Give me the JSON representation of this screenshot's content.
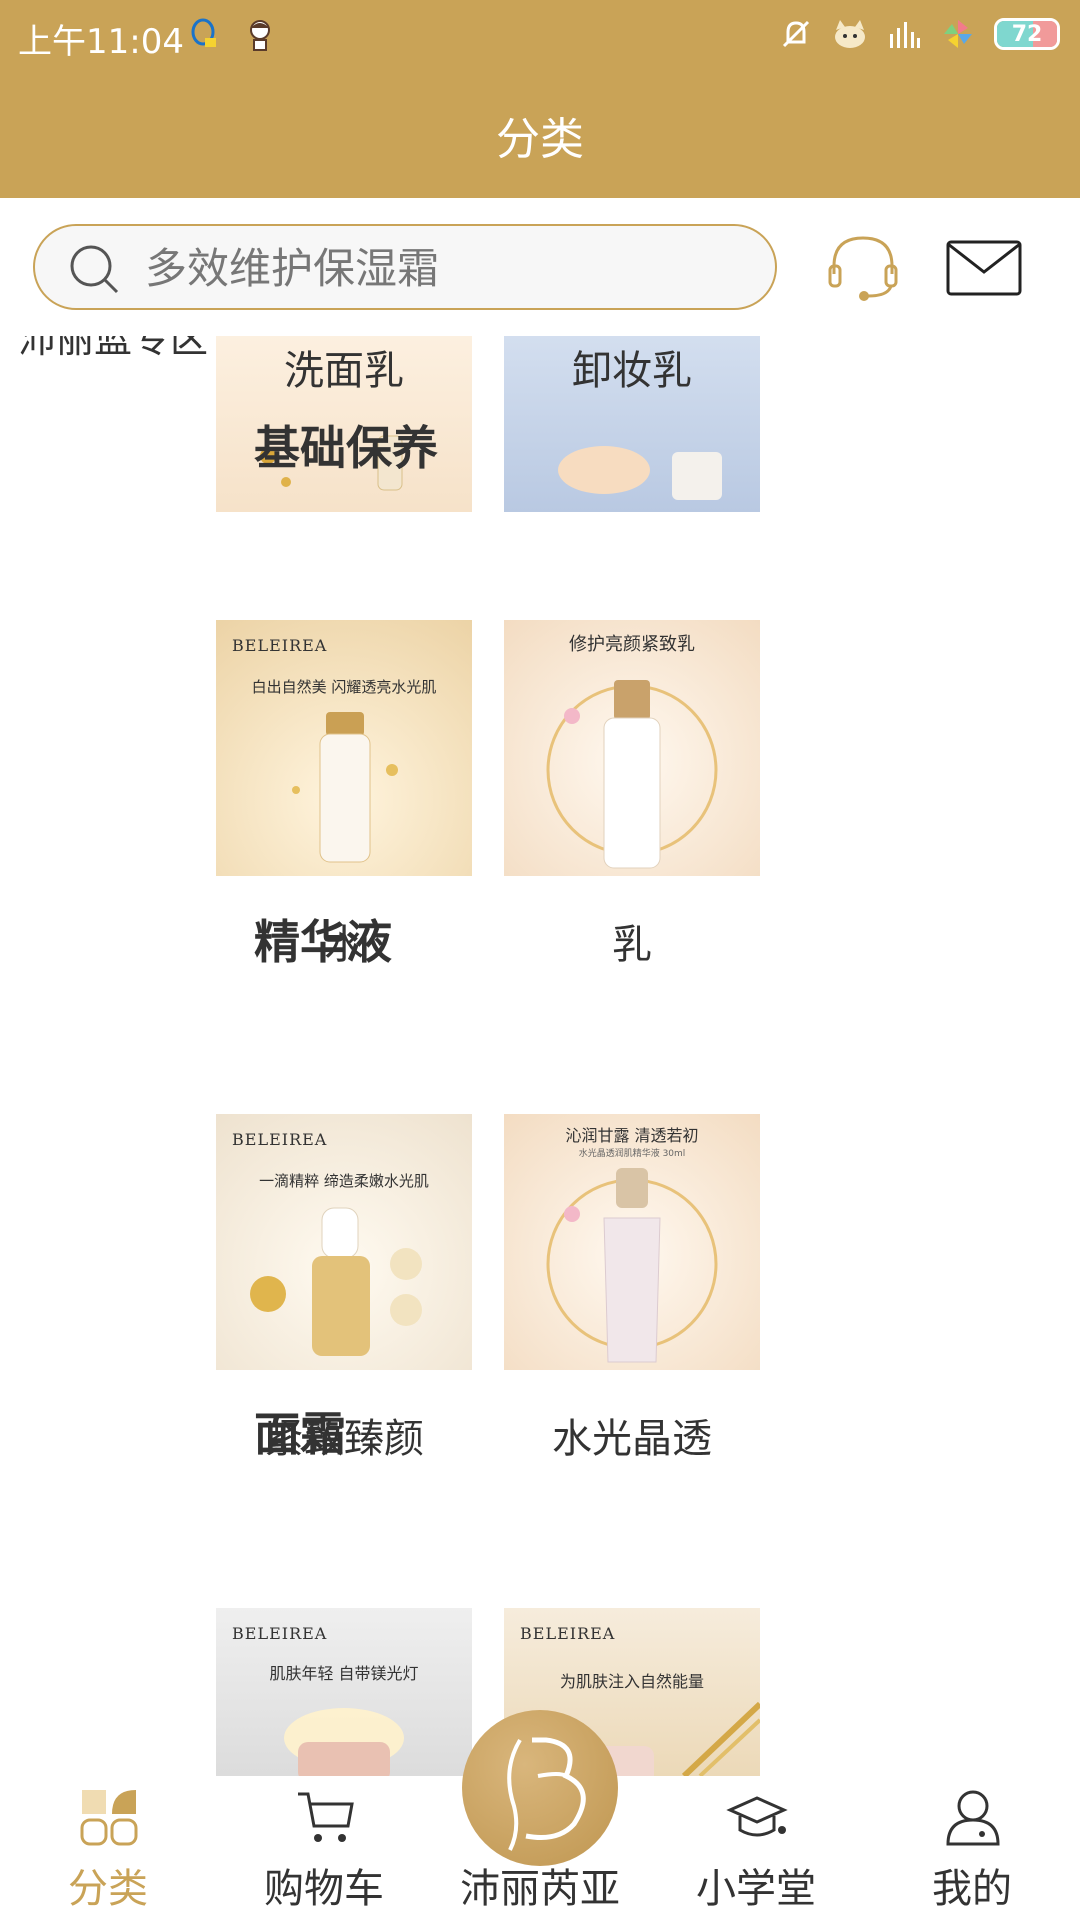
{
  "status_bar": {
    "time": "上午11:04",
    "battery": "72",
    "left_icons": [
      "qq-icon",
      "avatar-sticker-icon"
    ],
    "right_icons": [
      "mute-bell-icon",
      "cat-icon",
      "signal-icon",
      "pinwheel-icon"
    ]
  },
  "header": {
    "title": "分类"
  },
  "search": {
    "placeholder": "多效维护保湿霜"
  },
  "left_nav": {
    "active_category": "沛丽蓝专区"
  },
  "sections": [
    {
      "title": "",
      "items": [
        {
          "label": "洗面乳"
        },
        {
          "label": "卸妆乳"
        }
      ]
    },
    {
      "title": "基础保养",
      "items": [
        {
          "label": "水",
          "brand": "BELEIREA",
          "caption": "白出自然美  闪耀透亮水光肌"
        },
        {
          "label": "乳",
          "brand": "BELEIREA",
          "caption": "修护亮颜紧致乳"
        }
      ]
    },
    {
      "title": "精华液",
      "items": [
        {
          "label": "紧致臻颜",
          "brand": "BELEIREA",
          "caption": "一滴精粹 缔造柔嫩水光肌"
        },
        {
          "label": "水光晶透",
          "caption": "沁润甘露 清透若初",
          "sub": "水光晶透润肌精华液 30ml"
        }
      ]
    },
    {
      "title": "面霜",
      "items": [
        {
          "label": "",
          "brand": "BELEIREA",
          "caption": "肌肤年轻 自带镁光灯"
        },
        {
          "label": "",
          "brand": "BELEIREA",
          "caption": "为肌肤注入自然能量"
        }
      ]
    }
  ],
  "bottom_nav": [
    {
      "label": "分类",
      "icon": "category-grid-icon",
      "active": true
    },
    {
      "label": "购物车",
      "icon": "cart-icon",
      "active": false
    },
    {
      "label": "沛丽芮亚",
      "icon": "brand-logo-icon",
      "active": false
    },
    {
      "label": "小学堂",
      "icon": "graduation-cap-icon",
      "active": false
    },
    {
      "label": "我的",
      "icon": "user-icon",
      "active": false
    }
  ],
  "colors": {
    "brand": "#c9a357",
    "text": "#333333"
  }
}
